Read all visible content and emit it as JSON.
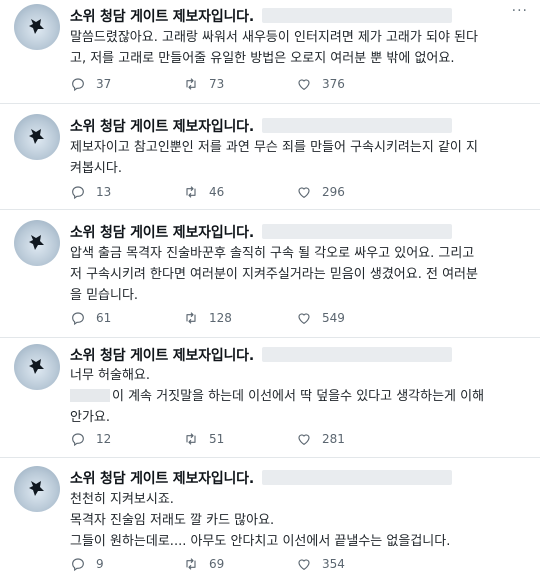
{
  "tweets": [
    {
      "author": "소위 청담 게이트 제보자입니다.",
      "text": [
        "말씀드렸잖아요. 고래랑 싸워서 새우등이 인터지려면 제가 고래가 되야 된다",
        "고, 저를 고래로 만들어줄 유일한 방법은 오로지 여러분 뿐 밖에 없어요."
      ],
      "replies": "37",
      "retweets": "73",
      "likes": "376"
    },
    {
      "author": "소위 청담 게이트 제보자입니다.",
      "text": [
        "제보자이고 참고인뿐인 저를 과연 무슨 죄를 만들어 구속시키려는지 같이 지",
        "켜봅시다."
      ],
      "replies": "13",
      "retweets": "46",
      "likes": "296"
    },
    {
      "author": "소위 청담 게이트 제보자입니다.",
      "text": [
        "압색 출금 목격자 진술바꾼후 솔직히 구속 될 각오로 싸우고 있어요. 그리고",
        "저 구속시키려 한다면 여러분이 지켜주실거라는 믿음이 생겼어요. 전 여러분",
        "을 믿습니다."
      ],
      "replies": "61",
      "retweets": "128",
      "likes": "549"
    },
    {
      "author": "소위 청담 게이트 제보자입니다.",
      "text": [
        "너무 허술해요.",
        "이 계속 거짓말을 하는데 이선에서 딱 덮을수 있다고 생각하는게 이해",
        "안가요."
      ],
      "replies": "12",
      "retweets": "51",
      "likes": "281"
    },
    {
      "author": "소위 청담 게이트 제보자입니다.",
      "text": [
        "천천히 지켜보시죠.",
        "목격자 진술임 저래도 깔 카드 많아요.",
        "그들이 원하는데로.... 아무도 안다치고 이선에서 끝낼수는 없을겁니다."
      ],
      "replies": "9",
      "retweets": "69",
      "likes": "354"
    }
  ],
  "icons": {
    "reply": "reply-icon",
    "retweet": "retweet-icon",
    "like": "heart-icon",
    "more": "more-icon"
  },
  "more_glyph": "···",
  "colors": {
    "text": "#0f1419",
    "muted": "#5b6670",
    "divider": "#e3e7ea",
    "redaction": "#e6e9ec"
  }
}
